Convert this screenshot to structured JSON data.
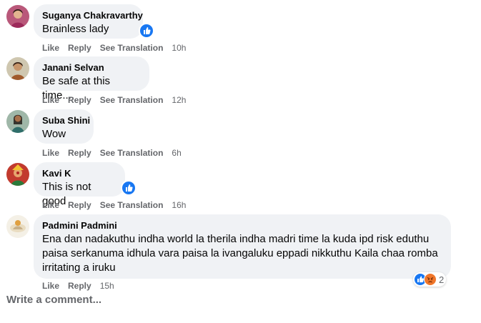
{
  "comments": [
    {
      "name": "Suganya Chakravarthy",
      "text": "Brainless lady",
      "time": "10h",
      "like": "Like",
      "reply": "Reply",
      "translate": "See Translation"
    },
    {
      "name": "Janani Selvan",
      "text": "Be safe at this time....",
      "time": "12h",
      "like": "Like",
      "reply": "Reply",
      "translate": "See Translation"
    },
    {
      "name": "Suba Shini",
      "text": "Wow",
      "time": "6h",
      "like": "Like",
      "reply": "Reply",
      "translate": "See Translation"
    },
    {
      "name": "Kavi K",
      "text": "This is not good",
      "time": "16h",
      "like": "Like",
      "reply": "Reply",
      "translate": "See Translation"
    },
    {
      "name": "Padmini Padmini",
      "text": "Ena dan nadakuthu indha world la therila indha madri time la kuda ipd risk eduthu paisa serkanuma idhula vara paisa la ivangaluku eppadi nikkuthu Kaila chaa romba irritating a iruku",
      "time": "15h",
      "like": "Like",
      "reply": "Reply",
      "reaction_count": "2"
    }
  ],
  "composer": {
    "placeholder": "Write a comment..."
  },
  "colors": {
    "like_blue": "#1877f2",
    "angry_orange": "#f0762a",
    "bubble": "#f0f2f5",
    "meta": "#65676b"
  }
}
